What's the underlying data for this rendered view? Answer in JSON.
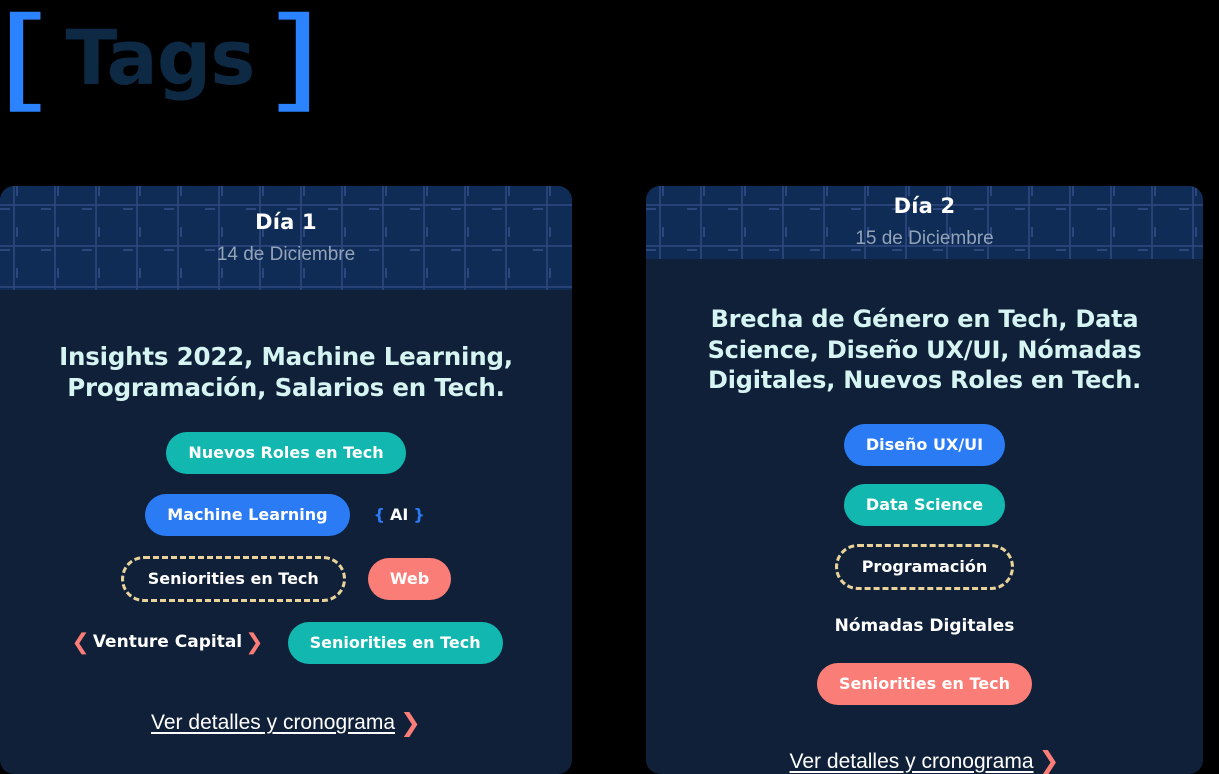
{
  "page": {
    "title_text": "Tags",
    "bracket_left": "[",
    "bracket_right": "]",
    "background_color": "#000000",
    "title_color": "#0d2944",
    "bracket_color": "#2b83ff"
  },
  "colors": {
    "card_body": "#0f2038",
    "card_header": "#0f2c56",
    "heading_text": "#d5f4f2",
    "teal": "#12b7b0",
    "blue": "#2b7bf5",
    "salmon": "#fb7d77",
    "dashed_border": "#e9d39b",
    "date_text": "#93a3b8"
  },
  "cards": [
    {
      "day_label": "Día 1",
      "date": "14 de Diciembre",
      "heading": "Insights 2022, Machine Learning, Programación, Salarios en Tech.",
      "tags": [
        {
          "label": "Nuevos Roles en Tech",
          "style": "teal"
        },
        {
          "label": "Machine Learning",
          "style": "blue"
        },
        {
          "label": "AI",
          "style": "braces"
        },
        {
          "label": "Seniorities en Tech",
          "style": "dashed"
        },
        {
          "label": "Web",
          "style": "salmon"
        },
        {
          "label": "Venture Capital",
          "style": "chevrons"
        },
        {
          "label": "Seniorities en Tech",
          "style": "teal"
        }
      ],
      "link_text": "Ver detalles y cronograma",
      "link_chevron": "❯"
    },
    {
      "day_label": "Día 2",
      "date": "15 de Diciembre",
      "heading": "Brecha de Género en Tech, Data Science, Diseño UX/UI, Nómadas Digitales, Nuevos Roles en Tech.",
      "tags": [
        {
          "label": "Diseño UX/UI",
          "style": "blue"
        },
        {
          "label": "Data Science",
          "style": "teal"
        },
        {
          "label": "Programación",
          "style": "dashed"
        },
        {
          "label": "Nómadas Digitales",
          "style": "plain"
        },
        {
          "label": "Seniorities en Tech",
          "style": "salmon"
        }
      ],
      "link_text": "Ver detalles y cronograma",
      "link_chevron": "❯"
    }
  ]
}
